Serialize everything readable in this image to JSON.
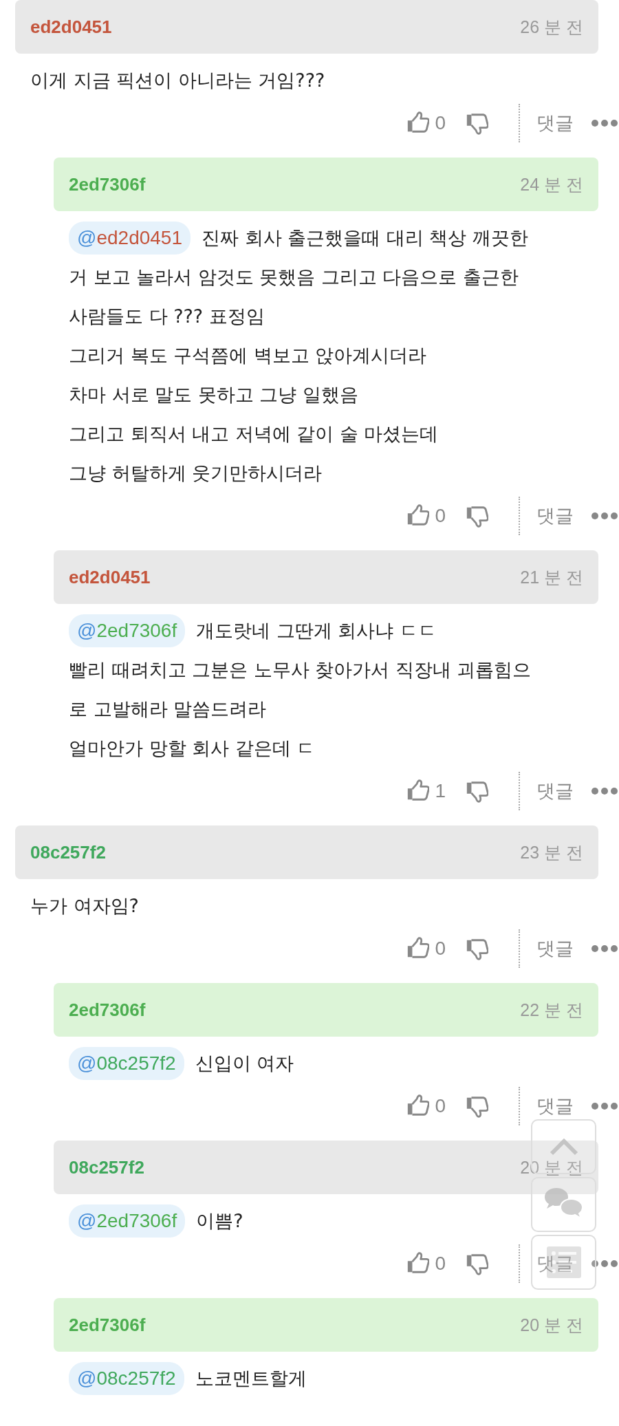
{
  "comments": [
    {
      "author": "ed2d0451",
      "color": "#c4553c",
      "highlighted": false,
      "time": "26 분 전",
      "paragraphs": [
        "이게 지금 픽션이 아니라는 거임???"
      ],
      "likes": "0",
      "reply": "댓글",
      "children": [
        {
          "author": "2ed7306f",
          "color": "#4cae50",
          "highlighted": true,
          "time": "24 분 전",
          "mention": {
            "at": "@",
            "name": "ed2d0451",
            "color": "#c4553c"
          },
          "paragraphs": [
            "진짜 회사 출근했을때 대리 책상 깨끗한",
            "거 보고 놀라서 암것도 못했음 그리고 다음으로 출근한",
            "사람들도 다 ??? 표정임",
            "그리거 복도 구석쯤에 벽보고 앉아계시더라",
            "차마 서로 말도 못하고 그냥 일했음",
            "그리고 퇴직서 내고 저녁에 같이 술 마셨는데",
            "그냥 허탈하게 웃기만하시더라"
          ],
          "likes": "0",
          "reply": "댓글"
        },
        {
          "author": "ed2d0451",
          "color": "#c4553c",
          "highlighted": false,
          "time": "21 분 전",
          "mention": {
            "at": "@",
            "name": "2ed7306f",
            "color": "#4cae50"
          },
          "paragraphs": [
            "개도랏네 그딴게 회사냐 ㄷㄷ",
            "빨리 때려치고 그분은 노무사 찾아가서 직장내 괴롭힘으",
            "로 고발해라 말씀드려라",
            "얼마안가 망할 회사 같은데 ㄷ"
          ],
          "likes": "1",
          "reply": "댓글"
        }
      ]
    },
    {
      "author": "08c257f2",
      "color": "#3fa85c",
      "highlighted": false,
      "time": "23 분 전",
      "paragraphs": [
        "누가 여자임?"
      ],
      "likes": "0",
      "reply": "댓글",
      "children": [
        {
          "author": "2ed7306f",
          "color": "#4cae50",
          "highlighted": true,
          "time": "22 분 전",
          "mention": {
            "at": "@",
            "name": "08c257f2",
            "color": "#3fa85c"
          },
          "paragraphs": [
            "신입이 여자"
          ],
          "likes": "0",
          "reply": "댓글"
        },
        {
          "author": "08c257f2",
          "color": "#3fa85c",
          "highlighted": false,
          "time": "20 분 전",
          "mention": {
            "at": "@",
            "name": "2ed7306f",
            "color": "#4cae50"
          },
          "paragraphs": [
            "이쁨?"
          ],
          "likes": "0",
          "reply": "댓글"
        },
        {
          "author": "2ed7306f",
          "color": "#4cae50",
          "highlighted": true,
          "time": "20 분 전",
          "mention": {
            "at": "@",
            "name": "08c257f2",
            "color": "#3fa85c"
          },
          "paragraphs": [
            "노코멘트할게"
          ]
        }
      ]
    }
  ]
}
